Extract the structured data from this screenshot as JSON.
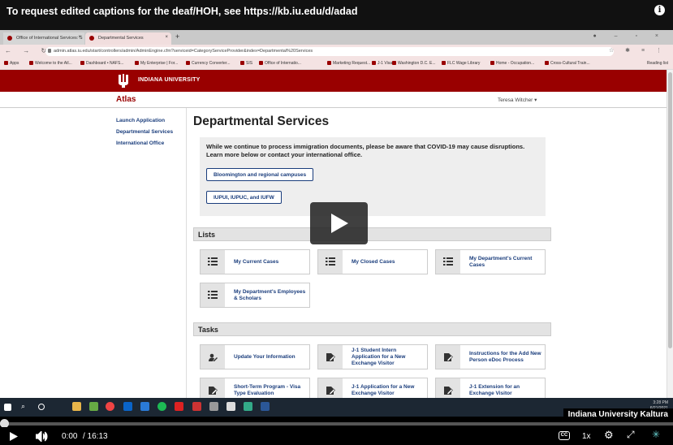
{
  "player": {
    "caption_notice": "To request edited captions for the deaf/HOH, see https://kb.iu.edu/d/adad",
    "current_time": "0:00",
    "duration": "/ 16:13",
    "speed": "1x",
    "branding": "Indiana University Kaltura"
  },
  "browser": {
    "tabs": [
      "Office of International Services: S",
      "Departmental Services"
    ],
    "url": "admin.atlas.iu.edu/start/controllers/admin/AdminEngine.cfm?serviceid=CategoryServiceProvider&index=Departmental%20Services",
    "bookmarks": [
      "Apps",
      "Welcome to the Atl...",
      "Dashboard • NAFS...",
      "My Enterprise | For...",
      "Currency Converter...",
      "SIS",
      "Office of Internatio...",
      "Marketing Request...",
      "J-1 Visa",
      "Washington D.C. E...",
      "FLC Wage Library",
      "Home - Occupation...",
      "Cross-Cultural Train..."
    ],
    "reading_list": "Reading list"
  },
  "site": {
    "org": "INDIANA UNIVERSITY",
    "app": "Atlas",
    "user": "Teresa Witcher",
    "nav": [
      "Launch Application",
      "Departmental Services",
      "International Office"
    ],
    "title": "Departmental Services",
    "notice": "While we continue to process immigration documents, please be aware that COVID-19 may cause disruptions. Learn more below or contact your international office.",
    "campus_buttons": [
      "Bloomington and regional campuses",
      "IUPUI, IUPUC, and IUFW"
    ],
    "lists_heading": "Lists",
    "lists": [
      "My Current Cases",
      "My Closed Cases",
      "My Department's Current Cases",
      "My Department's Employees & Scholars"
    ],
    "tasks_heading": "Tasks",
    "tasks": [
      "Update Your Information",
      "J-1 Student Intern Application for a New Exchange Visitor",
      "Instructions for the Add New Person eDoc Process",
      "Short-Term Program - Visa Type Evaluation",
      "J-1 Application for a New Exchange Visitor",
      "J-1 Extension for an Exchange Visitor"
    ]
  },
  "taskbar": {
    "time": "3:28 PM",
    "date": "6/21/2021"
  },
  "colors": {
    "iu_crimson": "#990000",
    "link_blue": "#1a3d7c"
  }
}
